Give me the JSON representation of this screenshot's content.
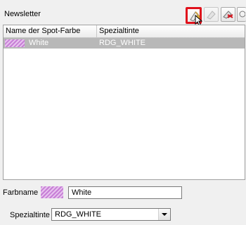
{
  "header": {
    "title": "Newsletter"
  },
  "toolbar": {
    "new_icon": "new-spot-color-icon",
    "edit_icon": "edit-spot-color-icon",
    "delete_icon": "delete-spot-color-icon",
    "more_icon": "more-icon"
  },
  "table": {
    "columns": [
      "Name der Spot-Farbe",
      "Spezialtinte"
    ],
    "rows": [
      {
        "name": "White",
        "ink": "RDG_WHITE",
        "swatch": "#c77fd6"
      }
    ]
  },
  "form": {
    "farbname_label": "Farbname :",
    "farbname_value": "White",
    "spezialtinte_label": "Spezialtinte :",
    "spezialtinte_value": "RDG_WHITE"
  },
  "colors": {
    "highlight_border": "#e0121c",
    "selected_row": "#b8b8b8",
    "swatch": "#c77fd6"
  }
}
